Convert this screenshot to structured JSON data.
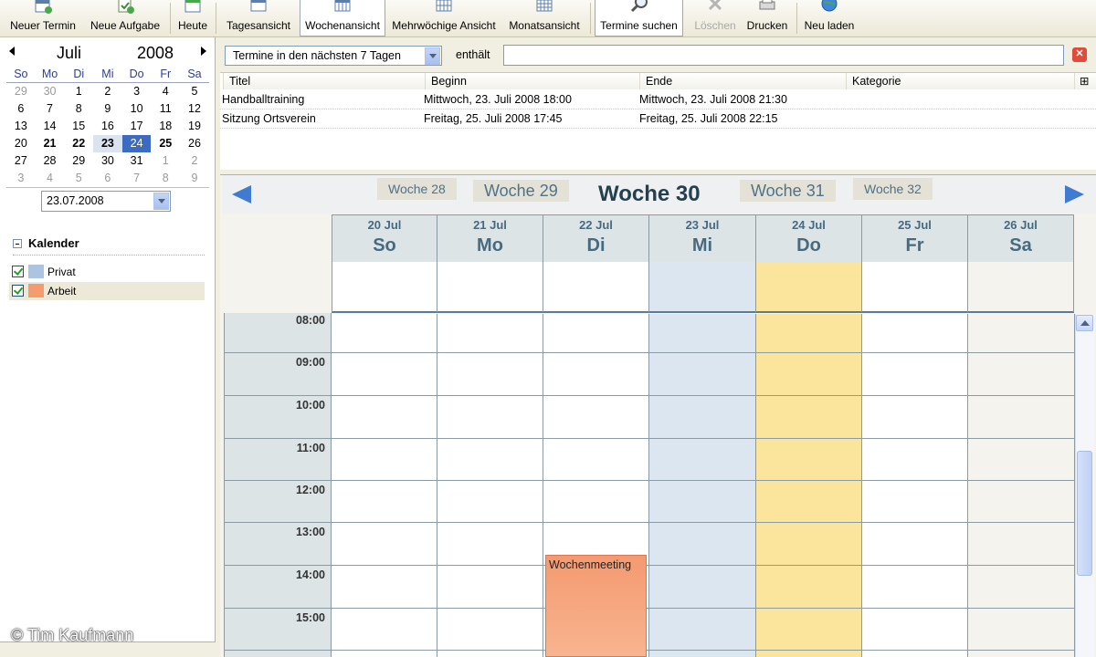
{
  "toolbar": {
    "new_appointment": "Neuer Termin",
    "new_task": "Neue Aufgabe",
    "today": "Heute",
    "day_view": "Tagesansicht",
    "week_view": "Wochenansicht",
    "multiweek_view": "Mehrwöchige Ansicht",
    "month_view": "Monatsansicht",
    "find_appointments": "Termine suchen",
    "delete": "Löschen",
    "print": "Drucken",
    "reload": "Neu laden"
  },
  "minical": {
    "month": "Juli",
    "year": "2008",
    "weekdays": [
      "So",
      "Mo",
      "Di",
      "Mi",
      "Do",
      "Fr",
      "Sa"
    ],
    "weeks": [
      [
        "29",
        "30",
        "1",
        "2",
        "3",
        "4",
        "5"
      ],
      [
        "6",
        "7",
        "8",
        "9",
        "10",
        "11",
        "12"
      ],
      [
        "13",
        "14",
        "15",
        "16",
        "17",
        "18",
        "19"
      ],
      [
        "20",
        "21",
        "22",
        "23",
        "24",
        "25",
        "26"
      ],
      [
        "27",
        "28",
        "29",
        "30",
        "31",
        "1",
        "2"
      ],
      [
        "3",
        "4",
        "5",
        "6",
        "7",
        "8",
        "9"
      ]
    ],
    "selected_date": "23.07.2008"
  },
  "calendars": {
    "title": "Kalender",
    "items": [
      {
        "label": "Privat",
        "color": "#aac4e2"
      },
      {
        "label": "Arbeit",
        "color": "#f59c6e"
      }
    ]
  },
  "search": {
    "range": "Termine in den nächsten 7 Tagen",
    "contains_label": "enthält",
    "value": ""
  },
  "results": {
    "columns": [
      "Titel",
      "Beginn",
      "Ende",
      "Kategorie"
    ],
    "rows": [
      {
        "title": "Handballtraining",
        "start": "Mittwoch, 23. Juli 2008 18:00",
        "end": "Mittwoch, 23. Juli 2008 21:30",
        "category": ""
      },
      {
        "title": "Sitzung Ortsverein",
        "start": "Freitag, 25. Juli 2008 17:45",
        "end": "Freitag, 25. Juli 2008 22:15",
        "category": ""
      }
    ]
  },
  "week": {
    "weeks": [
      "Woche 28",
      "Woche 29",
      "Woche 30",
      "Woche 31",
      "Woche 32"
    ],
    "days": [
      {
        "date": "20 Jul",
        "name": "So"
      },
      {
        "date": "21 Jul",
        "name": "Mo"
      },
      {
        "date": "22 Jul",
        "name": "Di"
      },
      {
        "date": "23 Jul",
        "name": "Mi"
      },
      {
        "date": "24 Jul",
        "name": "Do"
      },
      {
        "date": "25 Jul",
        "name": "Fr"
      },
      {
        "date": "26 Jul",
        "name": "Sa"
      }
    ],
    "hours": [
      "08:00",
      "09:00",
      "10:00",
      "11:00",
      "12:00",
      "13:00",
      "14:00",
      "15:00"
    ],
    "event": {
      "title": "Wochenmeeting",
      "color": "#f59c6e"
    },
    "colors": {
      "selected_day": "#dce6f1",
      "today": "#fbe49c"
    }
  },
  "watermark": "© Tim Kaufmann"
}
